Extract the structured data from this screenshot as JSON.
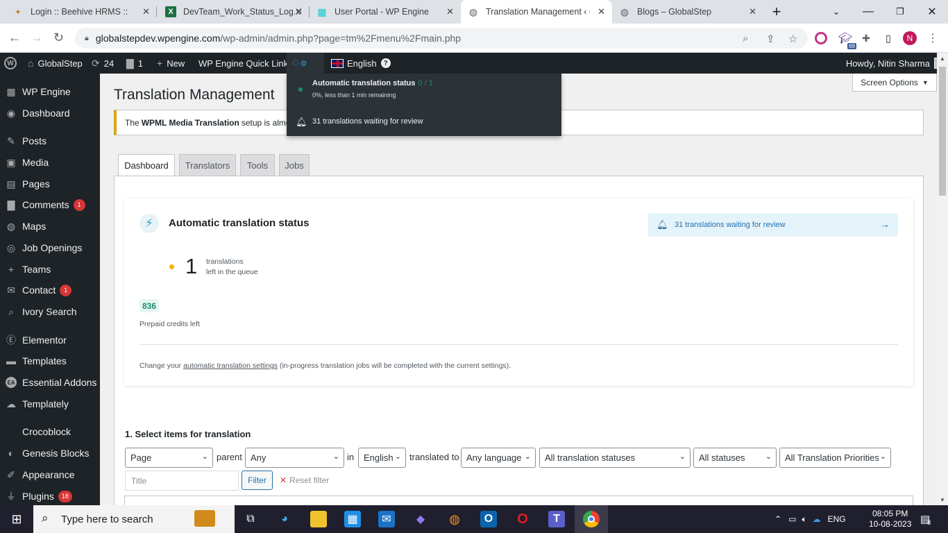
{
  "browser": {
    "tabs": [
      {
        "title": "Login :: Beehive HRMS ::",
        "icon": "bee-icon"
      },
      {
        "title": "DevTeam_Work_Status_Log.xl",
        "icon": "excel-icon"
      },
      {
        "title": "User Portal - WP Engine",
        "icon": "wpengine-icon"
      },
      {
        "title": "Translation Management ‹ Gl",
        "icon": "globe-icon"
      },
      {
        "title": "Blogs – GlobalStep",
        "icon": "globe-icon"
      }
    ],
    "url_host": "globalstepdev.wpengine.com",
    "url_path": "/wp-admin/admin.php?page=tm%2Fmenu%2Fmain.php",
    "profile_initial": "N",
    "ext_badge": "69"
  },
  "adminbar": {
    "site_name": "GlobalStep",
    "updates_count": "24",
    "comments_count": "1",
    "new_label": "New",
    "quick_links": "WP Engine Quick Links",
    "language": "English",
    "howdy": "Howdy, Nitin Sharma"
  },
  "sidebar": {
    "items": [
      {
        "label": "WP Engine",
        "icon": "grid-icon"
      },
      {
        "label": "Dashboard",
        "icon": "palette-icon"
      },
      {
        "label": "Posts",
        "icon": "pin-icon"
      },
      {
        "label": "Media",
        "icon": "media-icon"
      },
      {
        "label": "Pages",
        "icon": "page-icon"
      },
      {
        "label": "Comments",
        "icon": "comment-icon",
        "badge": "1"
      },
      {
        "label": "Maps",
        "icon": "globe-icon"
      },
      {
        "label": "Job Openings",
        "icon": "person-icon"
      },
      {
        "label": "Teams",
        "icon": "plus-icon"
      },
      {
        "label": "Contact",
        "icon": "mail-icon",
        "badge": "1"
      },
      {
        "label": "Ivory Search",
        "icon": "search-icon"
      },
      {
        "label": "Elementor",
        "icon": "elementor-icon"
      },
      {
        "label": "Templates",
        "icon": "folder-icon"
      },
      {
        "label": "Essential Addons",
        "icon": "ea-icon"
      },
      {
        "label": "Templately",
        "icon": "templately-icon"
      },
      {
        "label": "Crocoblock",
        "icon": ""
      },
      {
        "label": "Genesis Blocks",
        "icon": "genesis-icon"
      },
      {
        "label": "Appearance",
        "icon": "brush-icon"
      },
      {
        "label": "Plugins",
        "icon": "plug-icon",
        "badge": "18"
      }
    ]
  },
  "page": {
    "title": "Translation Management",
    "screen_options": "Screen Options",
    "notice_prefix": "The ",
    "notice_bold": "WPML Media Translation",
    "notice_suffix": " setup is almos",
    "tabs": [
      "Dashboard",
      "Translators",
      "Tools",
      "Jobs"
    ]
  },
  "status_card": {
    "title": "Automatic translation status",
    "review_link": "31 translations waiting for review",
    "queue_count": "1",
    "queue_line1": "translations",
    "queue_line2": "left in the queue",
    "credits": "836",
    "credits_label": "Prepaid credits left",
    "footer_prefix": "Change your ",
    "footer_link": "automatic translation settings",
    "footer_suffix": " (in-progress translation jobs will be completed with the current settings)."
  },
  "filters": {
    "section_title": "1. Select items for translation",
    "type": "Page",
    "parent_label": "parent",
    "parent": "Any",
    "in_label": "in",
    "source_lang": "English",
    "translated_label": "translated to",
    "target_lang": "Any language",
    "translation_status": "All translation statuses",
    "status": "All statuses",
    "priority": "All Translation Priorities",
    "title_placeholder": "Title",
    "filter_btn": "Filter",
    "reset": "Reset filter"
  },
  "popover": {
    "title": "Automatic translation status",
    "count": "0 / 1",
    "subtitle": "0%, less than 1 min remaining",
    "review": "31 translations waiting for review"
  },
  "taskbar": {
    "search_placeholder": "Type here to search",
    "lang": "ENG",
    "time": "08:05 PM",
    "date": "10-08-2023",
    "notif_count": "8"
  }
}
